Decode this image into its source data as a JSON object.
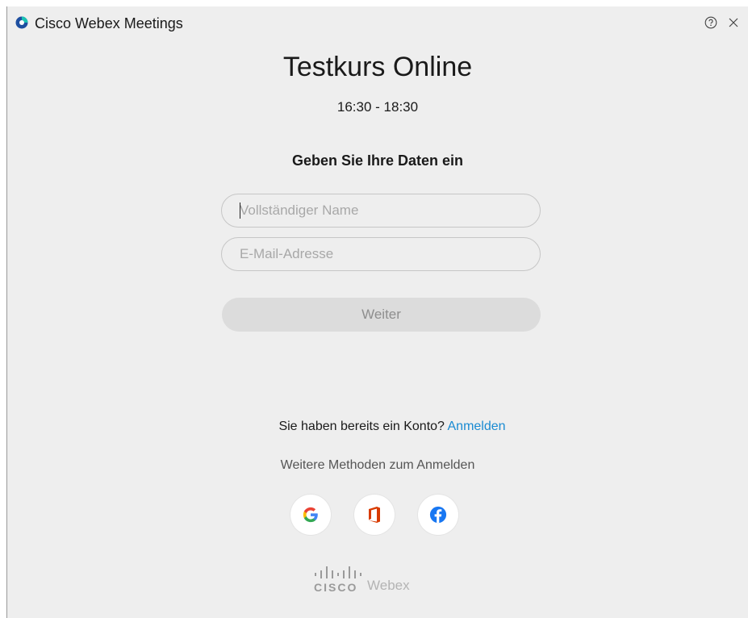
{
  "app": {
    "title": "Cisco Webex Meetings",
    "logo_icon": "webex-logo-icon",
    "help_icon": "help-icon",
    "close_icon": "close-icon"
  },
  "meeting": {
    "title": "Testkurs Online",
    "time": "16:30 - 18:30"
  },
  "form": {
    "heading": "Geben Sie Ihre Daten ein",
    "name_placeholder": "Vollständiger Name",
    "email_placeholder": "E-Mail-Adresse",
    "continue_label": "Weiter"
  },
  "account": {
    "question": "Sie haben bereits ein Konto?",
    "signin_label": "Anmelden",
    "more_methods": "Weitere Methoden zum Anmelden"
  },
  "social": [
    {
      "name": "google-icon"
    },
    {
      "name": "office-icon"
    },
    {
      "name": "facebook-icon"
    }
  ],
  "footer": {
    "cisco_text": "CISCO",
    "webex_text": "Webex"
  },
  "colors": {
    "link": "#1a8bd2",
    "background": "#eeeeee",
    "button_disabled": "#dcdcdc"
  }
}
